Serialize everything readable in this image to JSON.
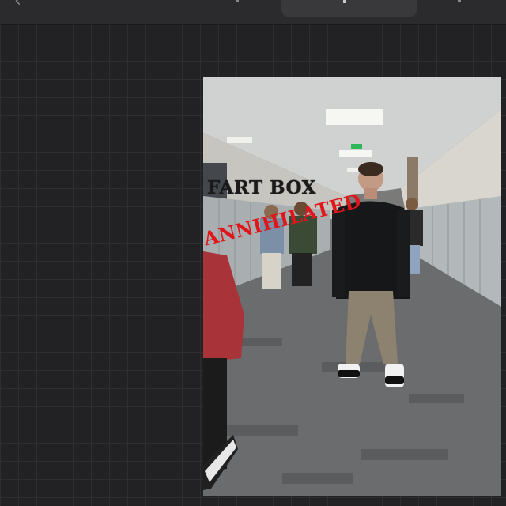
{
  "toolbar": {
    "back_icon": "chevron-left-icon",
    "back_glyph": "‹"
  },
  "sticker": {
    "line1": "FART BOX",
    "line2": "ANNIHILATED",
    "line2_color": "#e0161b"
  },
  "colors": {
    "app_background": "#1f1f21",
    "grid_line": "#2e2e31",
    "topbar": "#2b2b2e"
  }
}
